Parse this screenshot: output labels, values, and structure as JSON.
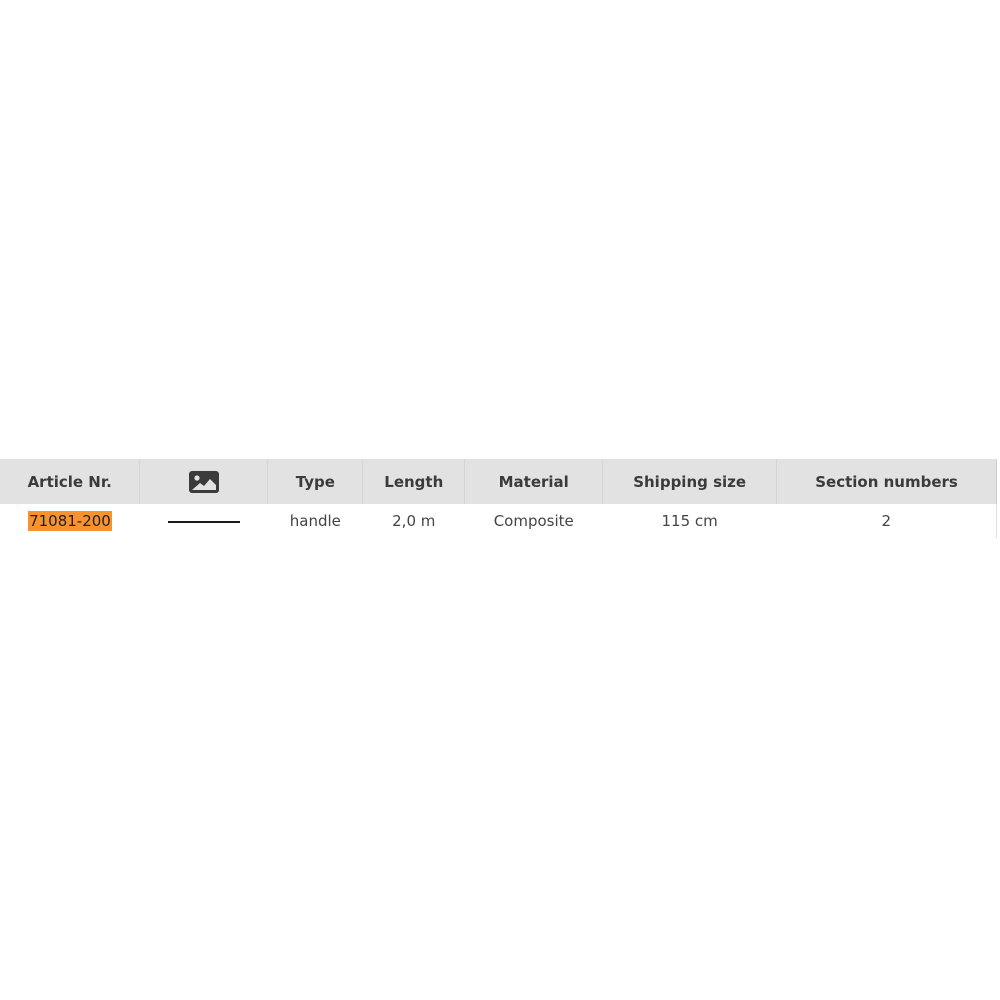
{
  "table": {
    "headers": [
      "Article Nr.",
      "image-icon",
      "Type",
      "Length",
      "Material",
      "Shipping size",
      "Section numbers"
    ],
    "rows": [
      {
        "article_nr": "71081-200",
        "image": "rod-thumbnail",
        "type": "handle",
        "length": "2,0 m",
        "material": "Composite",
        "shipping_size": "115 cm",
        "section_numbers": "2"
      }
    ]
  },
  "colors": {
    "header_bg": "#e2e2e2",
    "highlight": "#f7922f"
  }
}
